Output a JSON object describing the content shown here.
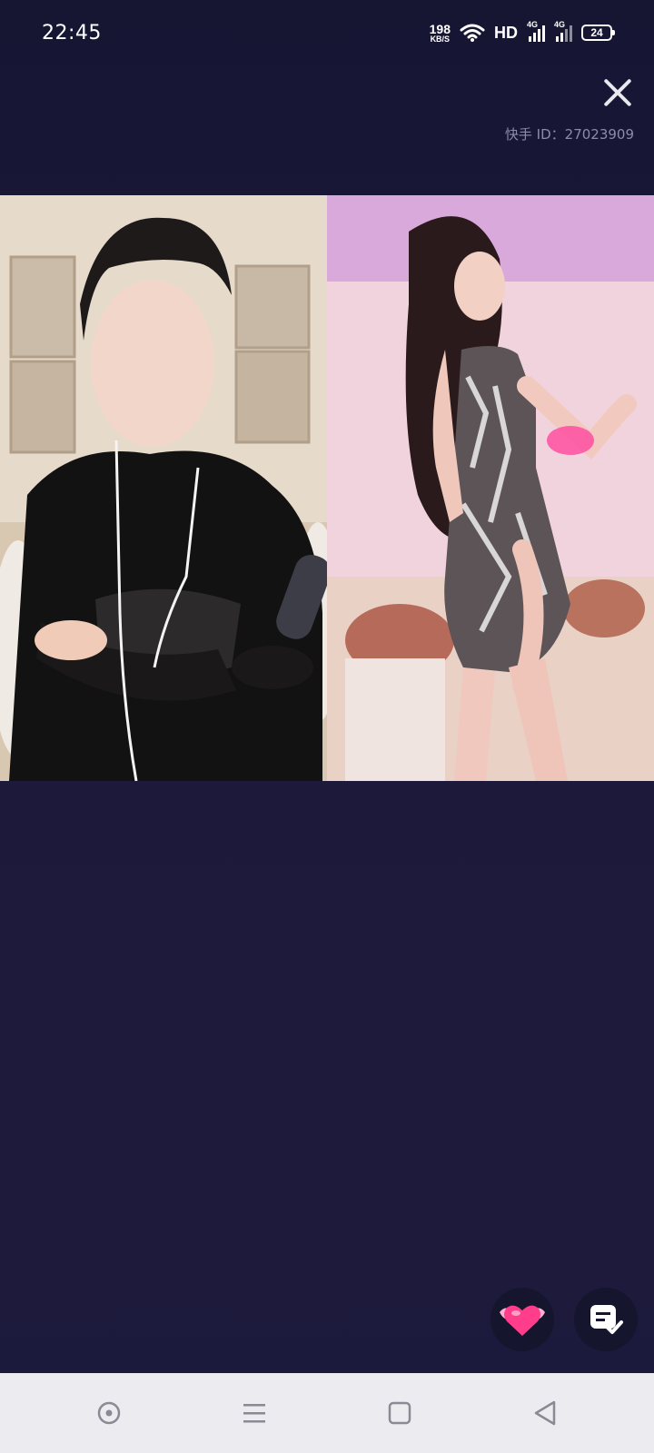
{
  "status_bar": {
    "time": "22:45",
    "net_speed": "198",
    "net_unit": "KB/S",
    "hd_label": "HD",
    "signal1_label": "4G",
    "signal2_label": "4G",
    "battery": "24"
  },
  "header": {
    "user_id": "快手 ID：27023909",
    "close_icon": "close-icon"
  },
  "videos": [
    {
      "name": "left-video-feed"
    },
    {
      "name": "right-video-feed"
    }
  ],
  "actions": {
    "heart_icon": "winged-heart-icon",
    "chat_icon": "message-check-icon"
  },
  "nav": {
    "items": [
      "record-icon",
      "menu-icon",
      "home-square-icon",
      "back-triangle-icon"
    ]
  },
  "colors": {
    "background": "#1c1a3c",
    "accent_heart": "#ff3d8b"
  }
}
